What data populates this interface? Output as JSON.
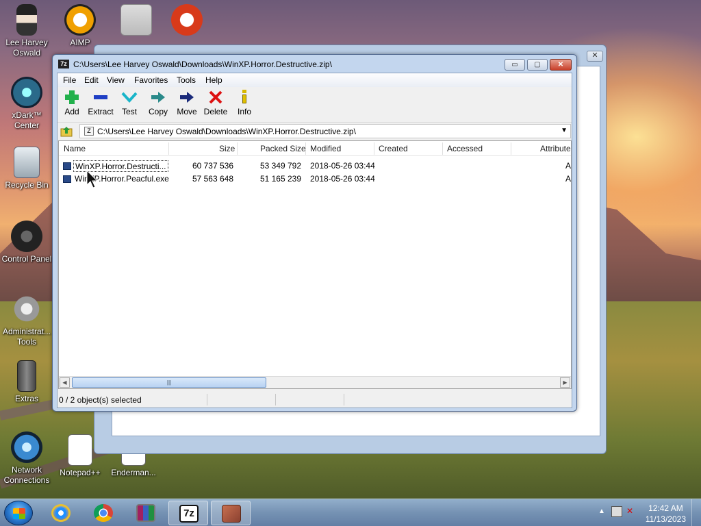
{
  "desktop_icons": [
    {
      "label": "Lee Harvey Oswald",
      "icon": "user-figure-icon"
    },
    {
      "label": "AIMP",
      "icon": "aimp-icon"
    },
    {
      "label": "xDark™ Center",
      "icon": "xdark-icon"
    },
    {
      "label": "Recycle Bin",
      "icon": "recycle-bin-icon"
    },
    {
      "label": "Control Panel",
      "icon": "control-panel-icon"
    },
    {
      "label": "Administrat... Tools",
      "icon": "admin-tools-icon"
    },
    {
      "label": "Extras",
      "icon": "extras-icon"
    },
    {
      "label": "Network Connections",
      "icon": "network-icon"
    },
    {
      "label": "Notepad++",
      "icon": "notepad-icon"
    },
    {
      "label": "Enderman...",
      "icon": "file-icon"
    }
  ],
  "window": {
    "title": "C:\\Users\\Lee Harvey Oswald\\Downloads\\WinXP.Horror.Destructive.zip\\",
    "app_icon_text": "7z",
    "buttons": {
      "minimize": "▭",
      "maximize": "▢",
      "close": "✕"
    }
  },
  "menu": [
    "File",
    "Edit",
    "View",
    "Favorites",
    "Tools",
    "Help"
  ],
  "toolbar": [
    {
      "label": "Add",
      "icon": "plus-icon",
      "color": "#22b14c"
    },
    {
      "label": "Extract",
      "icon": "minus-icon",
      "color": "#1f3fc4"
    },
    {
      "label": "Test",
      "icon": "check-icon",
      "color": "#19b5c9"
    },
    {
      "label": "Copy",
      "icon": "copy-arrow-icon",
      "color": "#2a8a8a"
    },
    {
      "label": "Move",
      "icon": "move-arrow-icon",
      "color": "#1a2a7a"
    },
    {
      "label": "Delete",
      "icon": "delete-x-icon",
      "color": "#d11"
    },
    {
      "label": "Info",
      "icon": "info-icon",
      "color": "#e0c000"
    }
  ],
  "address": {
    "path": "C:\\Users\\Lee Harvey Oswald\\Downloads\\WinXP.Horror.Destructive.zip\\"
  },
  "columns": [
    "Name",
    "Size",
    "Packed Size",
    "Modified",
    "Created",
    "Accessed",
    "Attribute"
  ],
  "files": [
    {
      "name": "WinXP.Horror.Destructi...",
      "size": "60 737 536",
      "packed": "53 349 792",
      "modified": "2018-05-26 03:44",
      "created": "",
      "accessed": "",
      "attr": "A"
    },
    {
      "name": "WinXP.Horror.Peacful.exe",
      "size": "57 563 648",
      "packed": "51 165 239",
      "modified": "2018-05-26 03:44",
      "created": "",
      "accessed": "",
      "attr": "A"
    }
  ],
  "status": {
    "selection": "0 / 2 object(s) selected"
  },
  "taskbar": {
    "apps": [
      "Internet Explorer",
      "Google Chrome",
      "WinRAR",
      "7-Zip",
      "Window Manager"
    ],
    "time": "12:42 AM",
    "date": "11/13/2023"
  }
}
